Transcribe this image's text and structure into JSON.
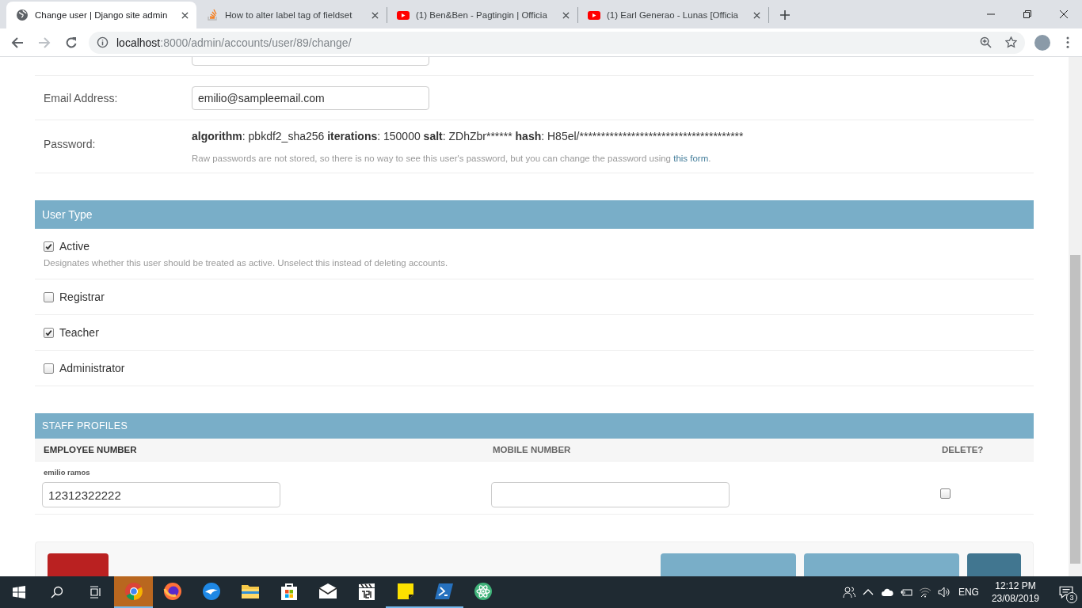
{
  "browser": {
    "tabs": [
      {
        "title": "Change user | Django site admin",
        "kind": "globe",
        "selected": true
      },
      {
        "title": "How to alter label tag of fieldset",
        "kind": "stack",
        "selected": false
      },
      {
        "title": "(1) Ben&Ben - Pagtingin | Officia",
        "kind": "video",
        "selected": false
      },
      {
        "title": "(1) Earl Generao - Lunas [Officia",
        "kind": "video",
        "selected": false
      }
    ],
    "url": {
      "host": "localhost",
      "path": ":8000/admin/accounts/user/89/change/"
    }
  },
  "form": {
    "fields": [
      {
        "kind": "empty-text"
      },
      {
        "label": "Email Address:",
        "value": "emilio@sampleemail.com"
      }
    ],
    "password": {
      "label": "Password:",
      "parts": [
        {
          "key": "algorithm",
          "value": ": pbkdf2_sha256"
        },
        {
          "key": "iterations",
          "value": ": 150000"
        },
        {
          "key": "salt",
          "value": ": ZDhZbr******"
        },
        {
          "key": "hash",
          "value": ": H85el/**************************************"
        }
      ],
      "help": {
        "before": "Raw passwords are not stored, so there is no way to see this user's password, but you can change the password using ",
        "link": "this form",
        "after": "."
      }
    }
  },
  "user_type": {
    "title": "User Type",
    "checkboxes": [
      {
        "label": "Active",
        "checked": true,
        "help": "Designates whether this user should be treated as active. Unselect this instead of deleting accounts."
      },
      {
        "label": "Registrar",
        "checked": false
      },
      {
        "label": "Teacher",
        "checked": true
      },
      {
        "label": "Administrator",
        "checked": false
      }
    ]
  },
  "staff_profiles": {
    "title": "STAFF PROFILES",
    "columns": [
      {
        "label": "EMPLOYEE NUMBER",
        "required": true
      },
      {
        "label": "MOBILE NUMBER",
        "required": false
      },
      {
        "label": "DELETE?",
        "required": false
      }
    ],
    "rows": [
      {
        "name": "emilio ramos",
        "employee_number": "12312322222",
        "mobile_number": "",
        "delete": false
      }
    ]
  },
  "submit_row": {
    "buttons": [
      {
        "kind": "delete"
      },
      {
        "kind": "secondary"
      },
      {
        "kind": "secondary"
      },
      {
        "kind": "primary"
      }
    ]
  },
  "taskbar": {
    "apps": [
      {
        "kind": "chrome",
        "active": true,
        "running": true
      },
      {
        "kind": "firefox",
        "active": false,
        "running": false
      },
      {
        "kind": "bird",
        "active": false,
        "running": false
      },
      {
        "kind": "folder",
        "active": false,
        "running": false
      },
      {
        "kind": "store",
        "active": false,
        "running": false
      },
      {
        "kind": "mail",
        "active": false,
        "running": false
      },
      {
        "kind": "clapper",
        "active": false,
        "running": false
      },
      {
        "kind": "note",
        "active": false,
        "running": true
      },
      {
        "kind": "terminal",
        "active": false,
        "running": true
      },
      {
        "kind": "atom",
        "active": false,
        "running": false
      }
    ],
    "language": "ENG",
    "time": "12:12 PM",
    "date": "23/08/2019",
    "notifications": "3"
  }
}
